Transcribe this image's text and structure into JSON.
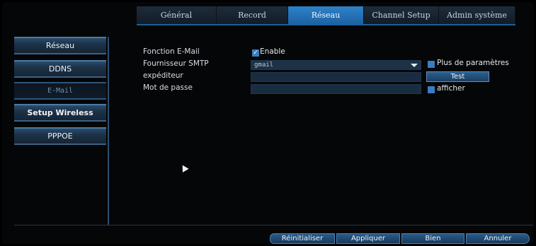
{
  "tabs": [
    {
      "label": "Général"
    },
    {
      "label": "Record"
    },
    {
      "label": "Réseau"
    },
    {
      "label": "Channel Setup"
    },
    {
      "label": "Admin système"
    }
  ],
  "sidebar": {
    "items": [
      {
        "label": "Réseau"
      },
      {
        "label": "DDNS"
      },
      {
        "label": "E-Mail"
      },
      {
        "label": "Setup Wireless"
      },
      {
        "label": "PPPOE"
      }
    ]
  },
  "form": {
    "email_function_label": "Fonction E-Mail",
    "enable_label": "Enable",
    "smtp_provider_label": "Fournisseur SMTP",
    "smtp_provider_value": "gmail",
    "more_params_label": "Plus de paramètres",
    "sender_label": "expéditeur",
    "sender_value": "",
    "test_label": "Test",
    "password_label": "Mot de passe",
    "password_value": "",
    "show_label": "afficher"
  },
  "footer": {
    "reset_label": "Réinitialiser",
    "apply_label": "Appliquer",
    "ok_label": "Bien",
    "cancel_label": "Annuler"
  },
  "colors": {
    "accent": "#2d82c9",
    "panel": "#1a2c3f"
  }
}
